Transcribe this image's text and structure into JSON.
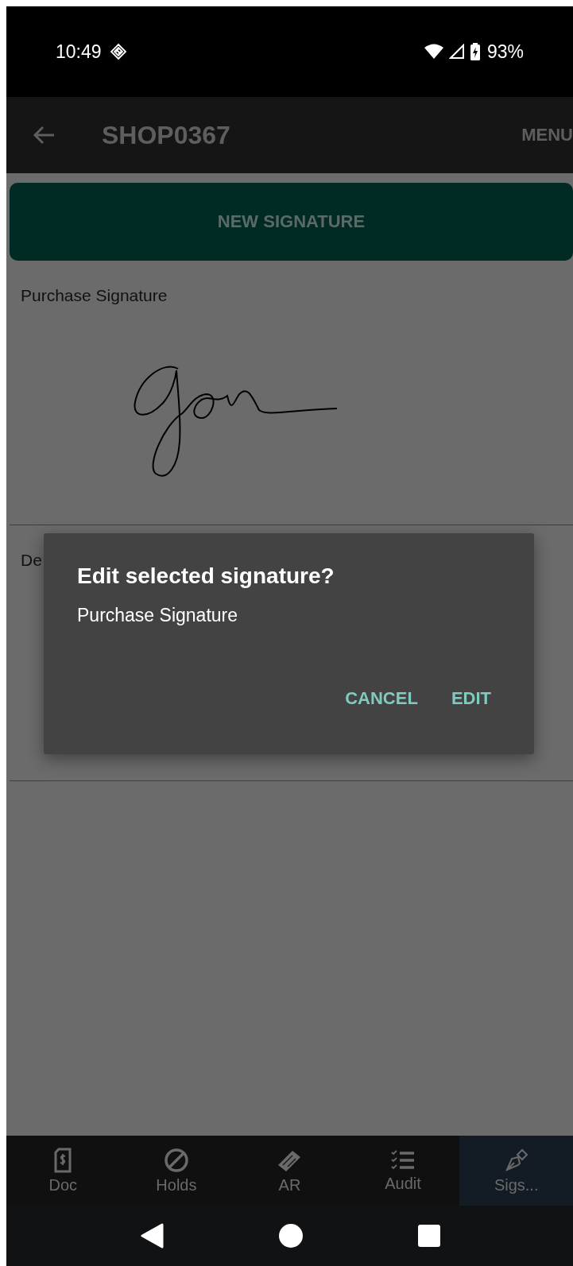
{
  "status_bar": {
    "time": "10:49",
    "battery": "93%"
  },
  "app_bar": {
    "title": "SHOP0367",
    "menu": "MENU"
  },
  "new_signature_button": "NEW SIGNATURE",
  "signatures": [
    {
      "label": "Purchase Signature"
    },
    {
      "label": "De"
    }
  ],
  "dialog": {
    "title": "Edit selected signature?",
    "message": "Purchase Signature",
    "buttons": [
      "CANCEL",
      "EDIT"
    ]
  },
  "bottom_nav": [
    {
      "kind": "doc",
      "label": "Doc",
      "selected": false
    },
    {
      "kind": "holds",
      "label": "Holds",
      "selected": false
    },
    {
      "kind": "ar",
      "label": "AR",
      "selected": false
    },
    {
      "kind": "audit",
      "label": "Audit",
      "selected": false
    },
    {
      "kind": "sigs",
      "label": "Sigs...",
      "selected": true
    }
  ]
}
